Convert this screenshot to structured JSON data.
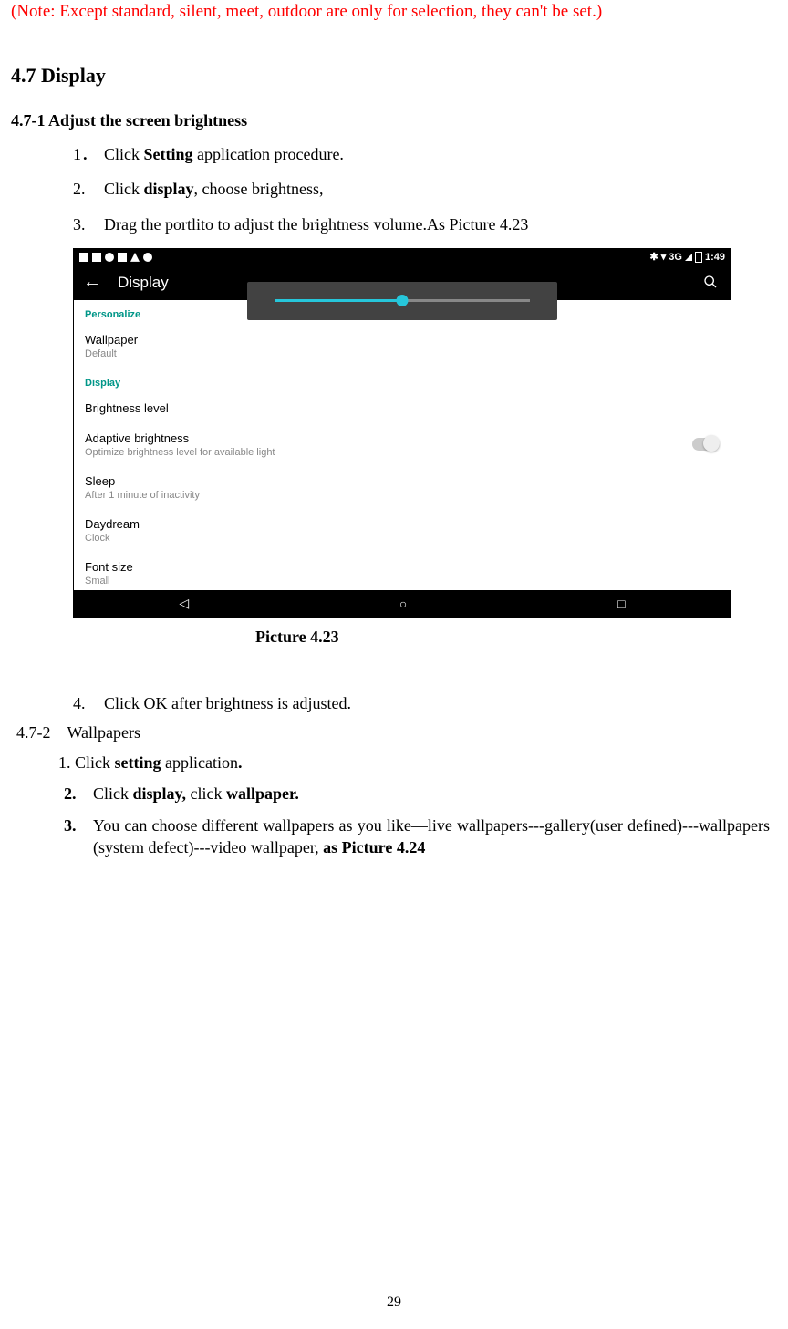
{
  "note": "(Note: Except standard, silent, meet, outdoor are only for selection, they can't be set.)",
  "section": {
    "heading": "4.7 Display",
    "sub1": {
      "heading": "4.7-1 Adjust the screen brightness",
      "steps": {
        "1": {
          "num": "1．",
          "t1": "Click ",
          "b1": "Setting",
          "t2": " application procedure."
        },
        "2": {
          "num": "2.",
          "t1": "Click ",
          "b1": "display",
          "t2": ", choose brightness,"
        },
        "3": {
          "num": "3.",
          "t1": "Drag the portlito to adjust the brightness volume.As Picture 4.23"
        },
        "4": {
          "num": "4.",
          "t1": "Click OK after brightness is adjusted."
        }
      }
    },
    "sub2": {
      "heading_num": "4.7-2",
      "heading_txt": "Wallpapers",
      "steps": {
        "1": {
          "t1": "1. Click ",
          "b1": "setting",
          "t2": " application",
          "b2": "."
        },
        "2": {
          "num": "2.",
          "t1": "Click ",
          "b1": "display,",
          "t2": " click ",
          "b2": "wallpaper."
        },
        "3": {
          "num": "3.",
          "t1": "You can choose different wallpapers as you like—live wallpapers---gallery(user defined)---wallpapers (system defect)---video wallpaper, ",
          "b1": "as Picture 4.24"
        }
      }
    }
  },
  "figure": {
    "caption": "Picture 4.23",
    "status": {
      "net": "3G",
      "time": "1:49"
    },
    "appbar_title": "Display",
    "sections": {
      "personalize": "Personalize",
      "wallpaper": {
        "t": "Wallpaper",
        "s": "Default"
      },
      "display": "Display",
      "brightness": {
        "t": "Brightness level"
      },
      "adaptive": {
        "t": "Adaptive brightness",
        "s": "Optimize brightness level for available light"
      },
      "sleep": {
        "t": "Sleep",
        "s": "After 1 minute of inactivity"
      },
      "daydream": {
        "t": "Daydream",
        "s": "Clock"
      },
      "font": {
        "t": "Font size",
        "s": "Small"
      }
    }
  },
  "page_number": "29"
}
